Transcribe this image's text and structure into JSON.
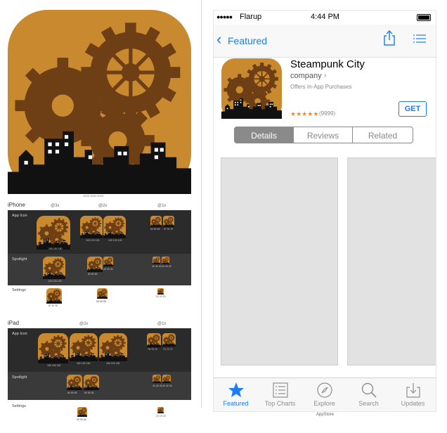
{
  "left": {
    "iphone_label": "iPhone",
    "ipad_label": "iPad",
    "scales_iphone": [
      "@3x",
      "@2x",
      "@1x"
    ],
    "scales_ipad": [
      "@2x",
      "@1x"
    ],
    "row_labels": {
      "app_icon": "App Icon",
      "spotlight": "Spotlight",
      "settings": "Settings"
    },
    "iphone_captions": {
      "app_icon": [
        "180 180 180",
        "120 120 120",
        "120 120 120",
        "60 60 60",
        "57 57 57"
      ],
      "spotlight": [
        "120 120 120",
        "80 80 80",
        "40 40 40",
        "40 40 40",
        "40 40 40"
      ],
      "settings": [
        "87 87 87",
        "58 58 58",
        "29 29 29"
      ]
    },
    "ipad_captions": {
      "app_icon": [
        "152 152 152",
        "152 152 152",
        "152 152 152",
        "76 76 76",
        "72 72 72"
      ],
      "spotlight": [
        "80 80 80",
        "80 80 80",
        "40 40 40",
        "40 40 40"
      ],
      "settings": [
        "58 58 58",
        "29 29 29"
      ]
    },
    "icon_caption": "1024 1024 1024"
  },
  "status": {
    "carrier": "Flarup",
    "time": "4:44 PM"
  },
  "nav": {
    "back_label": "Featured"
  },
  "app": {
    "name": "Steampunk City",
    "developer": "company",
    "iap": "Offers In-App Purchases",
    "stars": "★★★★★",
    "rating_count": "(9999)",
    "get_label": "GET"
  },
  "segments": [
    "Details",
    "Reviews",
    "Related"
  ],
  "tabs": [
    "Featured",
    "Top Charts",
    "Explore",
    "Search",
    "Updates"
  ],
  "footer": "AppStore",
  "colors": {
    "icon_bg": "#c8892f",
    "gear": "#6e3f14",
    "accent": "#1b7cf5"
  }
}
